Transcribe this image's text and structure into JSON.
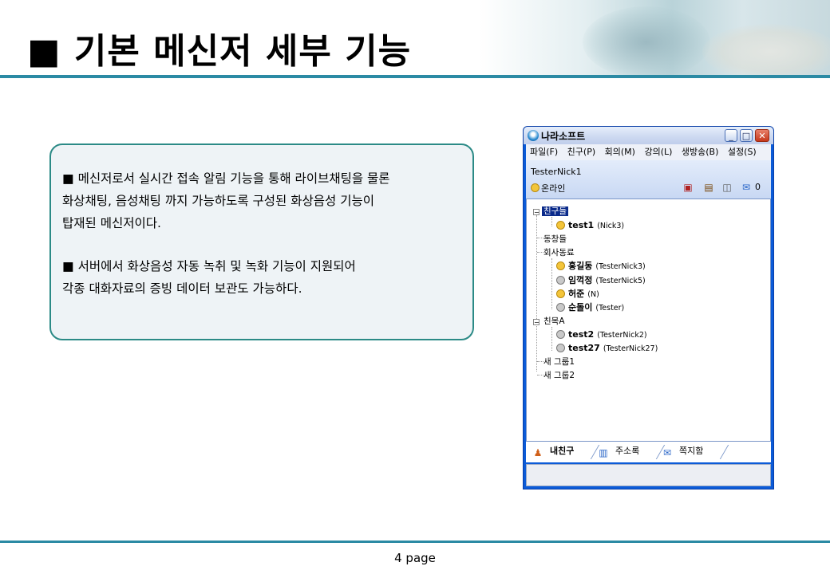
{
  "slide": {
    "title": "■ 기본 메신저 세부 기능",
    "page": "4 page"
  },
  "description": {
    "paragraph1": [
      "■ 메신저로서 실시간 접속 알림 기능을 통해 라이브채팅을 물론",
      "화상채팅, 음성채팅 까지 가능하도록 구성된 화상음성 기능이",
      "탑재된 메신저이다."
    ],
    "paragraph2": [
      "■ 서버에서 화상음성 자동 녹취 및 녹화 기능이 지원되어",
      "각종 대화자료의 증빙 데이터 보관도 가능하다."
    ]
  },
  "messenger": {
    "window_title": "나라소프트",
    "title_buttons": {
      "minimize": "_",
      "maximize": "□",
      "close": "✕"
    },
    "menu": [
      "파일(F)",
      "친구(P)",
      "회의(M)",
      "강의(L)",
      "생방송(B)",
      "설정(S)"
    ],
    "user": {
      "name": "TesterNick1",
      "status": "온라인",
      "message_count": "0",
      "icons": [
        "video-call-icon",
        "tv-icon",
        "group-icon",
        "note-icon"
      ]
    },
    "tree": {
      "groups": [
        {
          "name": "친구들",
          "selected": true,
          "members": [
            {
              "id": "test1",
              "nick": "(Nick3)",
              "online": true
            }
          ]
        },
        {
          "name": "동창들",
          "members": []
        },
        {
          "name": "회사동료",
          "members": [
            {
              "id": "홍길동",
              "nick": "(TesterNick3)",
              "online": true
            },
            {
              "id": "임꺽정",
              "nick": "(TesterNick5)",
              "online": false
            },
            {
              "id": "허준",
              "nick": "(N)",
              "online": true
            },
            {
              "id": "순돌이",
              "nick": "(Tester)",
              "online": false
            }
          ]
        },
        {
          "name": "친목A",
          "members": [
            {
              "id": "test2",
              "nick": "(TesterNick2)",
              "online": false
            },
            {
              "id": "test27",
              "nick": "(TesterNick27)",
              "online": false
            }
          ]
        },
        {
          "name": "새 그룹1",
          "members": []
        },
        {
          "name": "새 그룹2",
          "members": []
        }
      ]
    },
    "tabs": [
      {
        "label": "내친구",
        "active": true,
        "icon": "friends-icon"
      },
      {
        "label": "주소록",
        "active": false,
        "icon": "address-book-icon"
      },
      {
        "label": "쪽지함",
        "active": false,
        "icon": "note-box-icon"
      }
    ],
    "colors": {
      "frame": "#0b5bd8",
      "selection": "#0a2a8a",
      "online": "#f4c53a",
      "offline": "#c9c9c9"
    }
  },
  "theme": {
    "accent_line": "#2b8aa4",
    "box_border": "#2b8a86"
  }
}
